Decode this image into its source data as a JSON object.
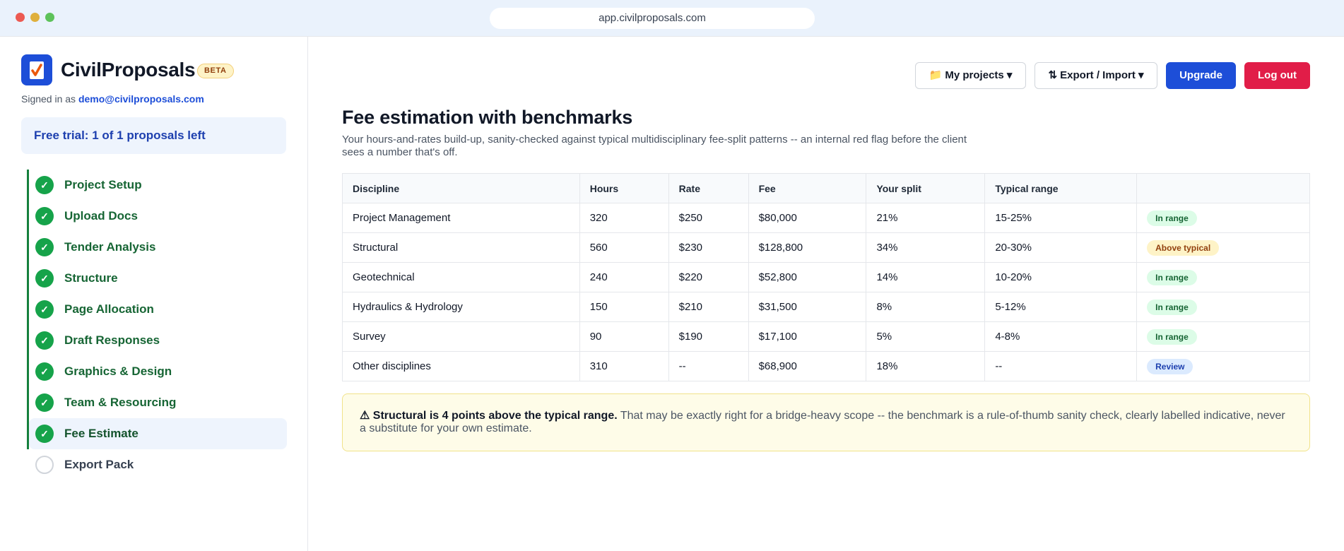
{
  "browser": {
    "url": "app.civilproposals.com"
  },
  "sidebar": {
    "brand": "CivilProposals",
    "beta": "BETA",
    "signed_in_prefix": "Signed in as",
    "email": "demo@civilproposals.com",
    "trial": "Free trial: 1 of 1 proposals left",
    "steps": [
      {
        "label": "Project Setup",
        "status": "done",
        "icon": "✓"
      },
      {
        "label": "Upload Docs",
        "status": "done",
        "icon": "✓"
      },
      {
        "label": "Tender Analysis",
        "status": "done",
        "icon": "✓"
      },
      {
        "label": "Structure",
        "status": "done",
        "icon": "✓"
      },
      {
        "label": "Page Allocation",
        "status": "done",
        "icon": "✓"
      },
      {
        "label": "Draft Responses",
        "status": "done",
        "icon": "✓"
      },
      {
        "label": "Graphics & Design",
        "status": "done",
        "icon": "✓"
      },
      {
        "label": "Team & Resourcing",
        "status": "done",
        "icon": "✓"
      },
      {
        "label": "Fee Estimate",
        "status": "current",
        "icon": "✓"
      },
      {
        "label": "Export Pack",
        "status": "todo",
        "icon": ""
      }
    ]
  },
  "toolbar": {
    "projects_label": "📁 My projects ▾",
    "export_label": "⇅ Export / Import ▾",
    "upgrade_label": "Upgrade",
    "logout_label": "Log out"
  },
  "main": {
    "title": "Fee estimation with benchmarks",
    "subtitle": "Your hours-and-rates build-up, sanity-checked against typical multidisciplinary fee-split patterns -- an internal red flag before the client sees a number that's off.",
    "table": {
      "headers": [
        "Discipline",
        "Hours",
        "Rate",
        "Fee",
        "Your split",
        "Typical range",
        ""
      ],
      "rows": [
        [
          "Project Management",
          "320",
          "$250",
          "$80,000",
          "21%",
          "15-25%",
          "In range"
        ],
        [
          "Structural",
          "560",
          "$230",
          "$128,800",
          "34%",
          "20-30%",
          "Above typical"
        ],
        [
          "Geotechnical",
          "240",
          "$220",
          "$52,800",
          "14%",
          "10-20%",
          "In range"
        ],
        [
          "Hydraulics & Hydrology",
          "150",
          "$210",
          "$31,500",
          "8%",
          "5-12%",
          "In range"
        ],
        [
          "Survey",
          "90",
          "$190",
          "$17,100",
          "5%",
          "4-8%",
          "In range"
        ],
        [
          "Other disciplines",
          "310",
          "--",
          "$68,900",
          "18%",
          "--",
          "Review"
        ]
      ]
    },
    "alert": {
      "icon": "⚠",
      "heading": "Structural is 4 points above the typical range.",
      "body": "That may be exactly right for a bridge-heavy scope -- the benchmark is a rule-of-thumb sanity check, clearly labelled indicative, never a substitute for your own estimate."
    }
  },
  "colors": {
    "accent": "#1d4ed8",
    "danger": "#e11d48",
    "success": "#16a34a",
    "warning_bg": "#fefce8"
  }
}
